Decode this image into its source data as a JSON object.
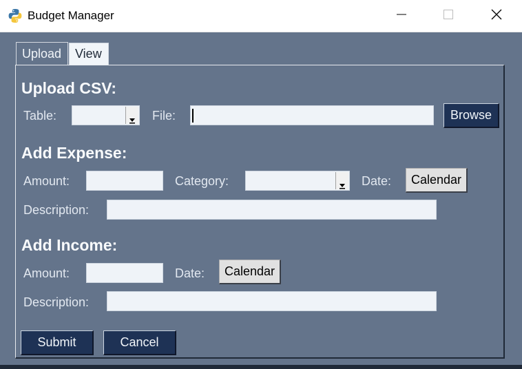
{
  "window": {
    "title": "Budget Manager",
    "app_icon": "python-logo-icon",
    "controls": [
      "minimize-icon",
      "maximize-icon",
      "close-icon"
    ]
  },
  "tabs": [
    {
      "label": "Upload",
      "selected": true
    },
    {
      "label": "View",
      "selected": false
    }
  ],
  "upload_csv": {
    "heading": "Upload CSV:",
    "table_label": "Table:",
    "table_value": "",
    "file_label": "File:",
    "file_value": "",
    "browse_label": "Browse"
  },
  "add_expense": {
    "heading": "Add Expense:",
    "amount_label": "Amount:",
    "amount_value": "",
    "category_label": "Category:",
    "category_value": "",
    "date_label": "Date:",
    "calendar_label": "Calendar",
    "description_label": "Description:",
    "description_value": ""
  },
  "add_income": {
    "heading": "Add Income:",
    "amount_label": "Amount:",
    "amount_value": "",
    "date_label": "Date:",
    "calendar_label": "Calendar",
    "description_label": "Description:",
    "description_value": ""
  },
  "actions": {
    "submit_label": "Submit",
    "cancel_label": "Cancel"
  },
  "colors": {
    "background": "#64748b",
    "dark_button": "#1e3255",
    "field": "#eff3f8"
  }
}
